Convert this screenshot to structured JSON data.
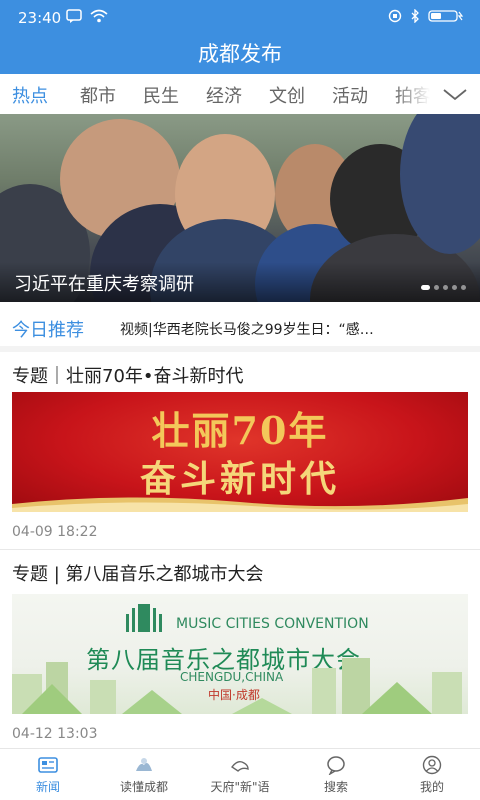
{
  "status_bar": {
    "time": "23:40"
  },
  "header": {
    "title": "成都发布"
  },
  "tabs": [
    {
      "label": "热点",
      "active": true
    },
    {
      "label": "都市",
      "active": false
    },
    {
      "label": "民生",
      "active": false
    },
    {
      "label": "经济",
      "active": false
    },
    {
      "label": "文创",
      "active": false
    },
    {
      "label": "活动",
      "active": false
    },
    {
      "label": "拍客",
      "active": false
    }
  ],
  "banner": {
    "caption": "习近平在重庆考察调研",
    "slide_count": 5,
    "current_slide": 1
  },
  "recommend": {
    "label": "今日推荐",
    "headline": "视频|华西老院长马俊之99岁生日：“感…"
  },
  "articles": [
    {
      "title": "专题｜壮丽70年•奋斗新时代",
      "image_text_line1": "壮丽70年",
      "image_text_line2": "奋斗新时代",
      "time": "04-09 18:22"
    },
    {
      "title": "专题 | 第八届音乐之都城市大会",
      "image_text_en": "MUSIC CITIES CONVENTION",
      "image_text_cn": "第八届音乐之都城市大会",
      "image_text_city": "CHENGDU,CHINA",
      "image_text_sub": "中国·成都",
      "time": "04-12 13:03"
    }
  ],
  "bottom_nav": [
    {
      "label": "新闻",
      "icon": "news-icon",
      "active": true
    },
    {
      "label": "读懂成都",
      "icon": "read-chengdu-icon",
      "active": false
    },
    {
      "label": "天府\"新\"语",
      "icon": "tianfu-icon",
      "active": false
    },
    {
      "label": "搜索",
      "icon": "search-icon",
      "active": false
    },
    {
      "label": "我的",
      "icon": "profile-icon",
      "active": false
    }
  ],
  "colors": {
    "brand_blue": "#3d8fe0",
    "text_dark": "#222222",
    "text_muted": "#888888"
  }
}
